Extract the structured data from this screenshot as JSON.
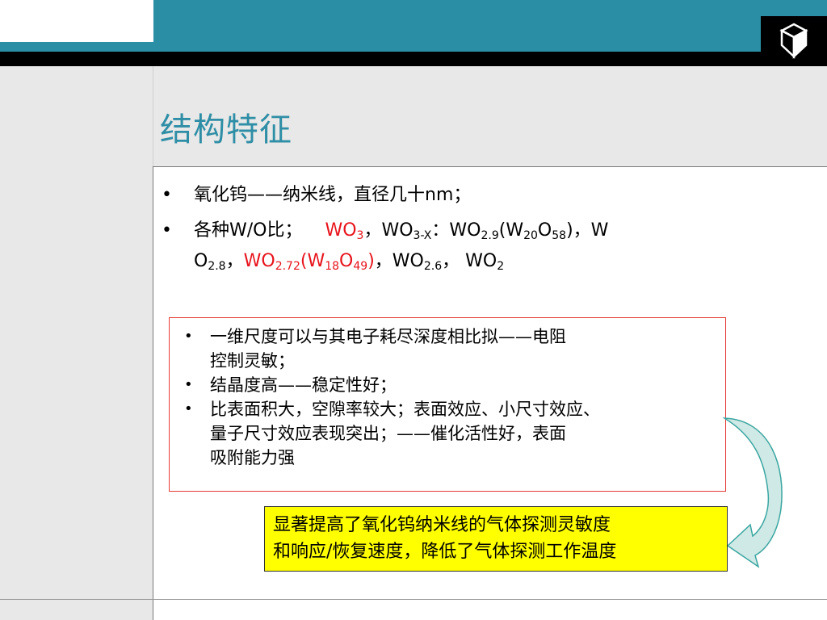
{
  "slide": {
    "title": "结构特征",
    "bullets": [
      {
        "marker": "•",
        "text": "氧化钨——纳米线，直径几十nm；"
      },
      {
        "marker": "•",
        "line1": {
          "p1": "各种W/O比；",
          "wo3": "WO",
          "wo3_sub": "3",
          "p2": "，WO",
          "sub2": "3-X",
          "p3": "：WO",
          "sub3": "2.9",
          "p4": "(W",
          "sub4": "20",
          "p5": "O",
          "sub5": "58",
          "p6": ")，W"
        },
        "line2": {
          "p1": "O",
          "sub1": "2.8",
          "p2": "，",
          "red1": "WO",
          "red_sub1": "2.72",
          "red2": "(W",
          "red_sub2": "18",
          "red3": "O",
          "red_sub3": "49",
          "red4": ")",
          "p3": "，WO",
          "sub2": "2.6",
          "p4": "， WO",
          "sub3": "2"
        }
      }
    ],
    "box_items": [
      {
        "marker": "•",
        "lines": [
          "一维尺度可以与其电子耗尽深度相比拟——电阻",
          "控制灵敏；"
        ]
      },
      {
        "marker": "•",
        "lines": [
          "结晶度高——稳定性好；"
        ]
      },
      {
        "marker": "•",
        "lines": [
          "比表面积大，空隙率较大；表面效应、小尺寸效应、",
          "量子尺寸效应表现突出；——催化活性好，表面",
          "吸附能力强"
        ]
      }
    ],
    "conclusion": {
      "line1": "显著提高了氧化钨纳米线的气体探测灵敏度",
      "line2": "和响应/恢复速度，降低了气体探测工作温度"
    },
    "colors": {
      "title": "#2e8ea6",
      "header_bar": "#2a8fa4",
      "highlight": "#e8141c",
      "box_border": "#e53935",
      "conclusion_bg": "#ffff00",
      "arrow": "#cfe9e6"
    },
    "icons": {
      "logo": "cube-icon",
      "arrow": "curved-arrow-icon"
    }
  }
}
